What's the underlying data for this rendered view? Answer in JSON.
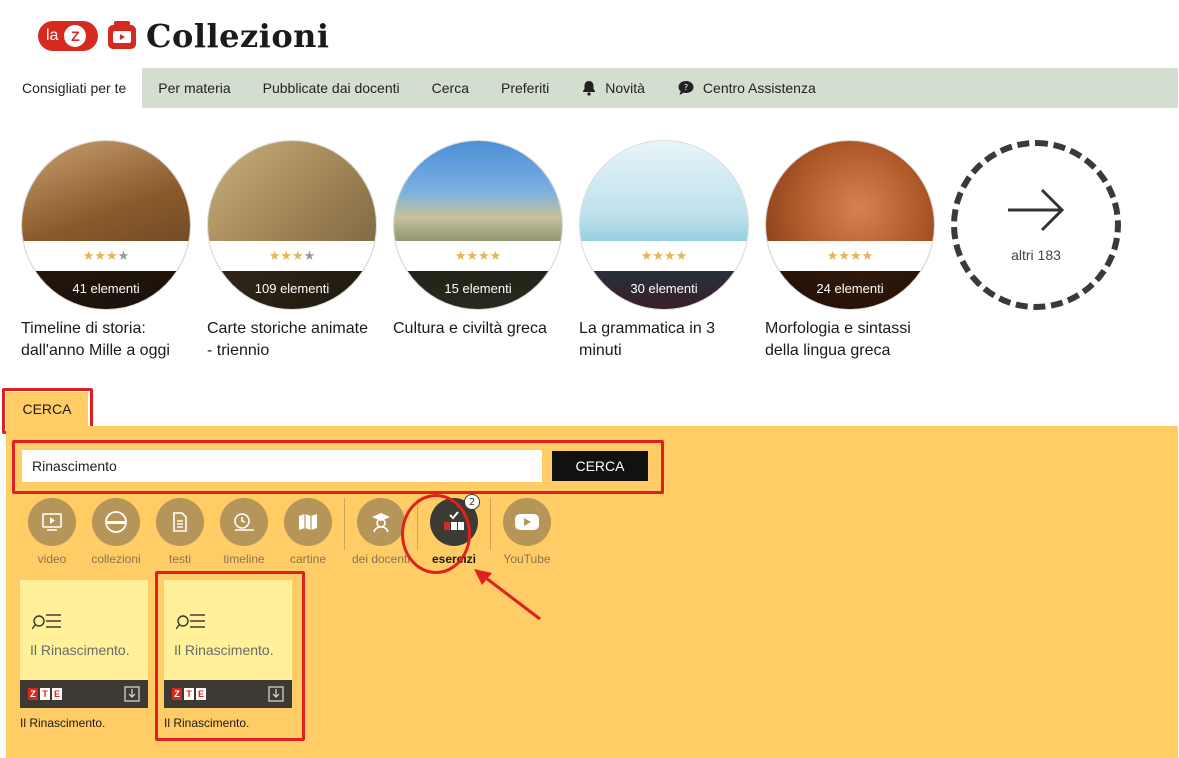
{
  "header": {
    "brand_prefix": "la",
    "brand_z": "Z",
    "title": "Collezioni"
  },
  "nav": {
    "items": [
      {
        "label": "Consigliati per te",
        "active": true
      },
      {
        "label": "Per materia"
      },
      {
        "label": "Pubblicate dai docenti"
      },
      {
        "label": "Cerca"
      },
      {
        "label": "Preferiti"
      },
      {
        "label": "Novità",
        "icon": "bell-icon"
      },
      {
        "label": "Centro Assistenza",
        "icon": "help-chat-icon"
      }
    ]
  },
  "collections": [
    {
      "title": "Timeline di storia: dall'anno Mille a oggi",
      "count": "41 elementi",
      "stars": 3,
      "max_stars": 4,
      "colors": [
        "#8a5a2b",
        "#c9a070",
        "#5a3a20"
      ]
    },
    {
      "title": "Carte storiche animate - triennio",
      "count": "109 elementi",
      "stars": 3,
      "max_stars": 4,
      "colors": [
        "#a88a5a",
        "#6e5a3a",
        "#c8b080"
      ]
    },
    {
      "title": "Cultura e civiltà greca",
      "count": "15 elementi",
      "stars": 4,
      "max_stars": 4,
      "colors": [
        "#4d8fd6",
        "#c8c0a0",
        "#6a7a4a"
      ]
    },
    {
      "title": "La grammatica in 3 minuti",
      "count": "30 elementi",
      "stars": 4,
      "max_stars": 4,
      "colors": [
        "#e8f4f8",
        "#7ac4d8",
        "#d06a9a"
      ]
    },
    {
      "title": "Morfologia e sintassi della lingua greca",
      "count": "24 elementi",
      "stars": 4,
      "max_stars": 4,
      "colors": [
        "#b05a2a",
        "#d88050",
        "#6a2a10"
      ]
    }
  ],
  "more": {
    "label": "altri 183"
  },
  "search_tab": {
    "label": "CERCA"
  },
  "search": {
    "value": "Rinascimento",
    "button": "CERCA"
  },
  "filters": [
    {
      "label": "video",
      "icon": "video-icon"
    },
    {
      "label": "collezioni",
      "icon": "collection-icon"
    },
    {
      "label": "testi",
      "icon": "document-icon"
    },
    {
      "label": "timeline",
      "icon": "timeline-icon"
    },
    {
      "label": "cartine",
      "icon": "map-icon"
    },
    {
      "label": "dei docenti",
      "icon": "teacher-icon"
    },
    {
      "label": "esercizi",
      "icon": "exercise-icon",
      "active": true,
      "badge": "2"
    },
    {
      "label": "YouTube",
      "icon": "youtube-icon"
    }
  ],
  "results": [
    {
      "title": "Il Rinascimento.",
      "caption": "Il Rinascimento.",
      "logo": [
        "Z",
        "T",
        "E"
      ]
    },
    {
      "title": "Il Rinascimento.",
      "caption": "Il Rinascimento.",
      "logo": [
        "Z",
        "T",
        "E"
      ]
    }
  ],
  "accent": {
    "red": "#d52b1e",
    "nav_bg": "#d3ded0",
    "panel_bg": "#ffcc66",
    "card_bg": "#fff099",
    "filter_bg": "#b5955a",
    "highlight": "#e02020"
  }
}
